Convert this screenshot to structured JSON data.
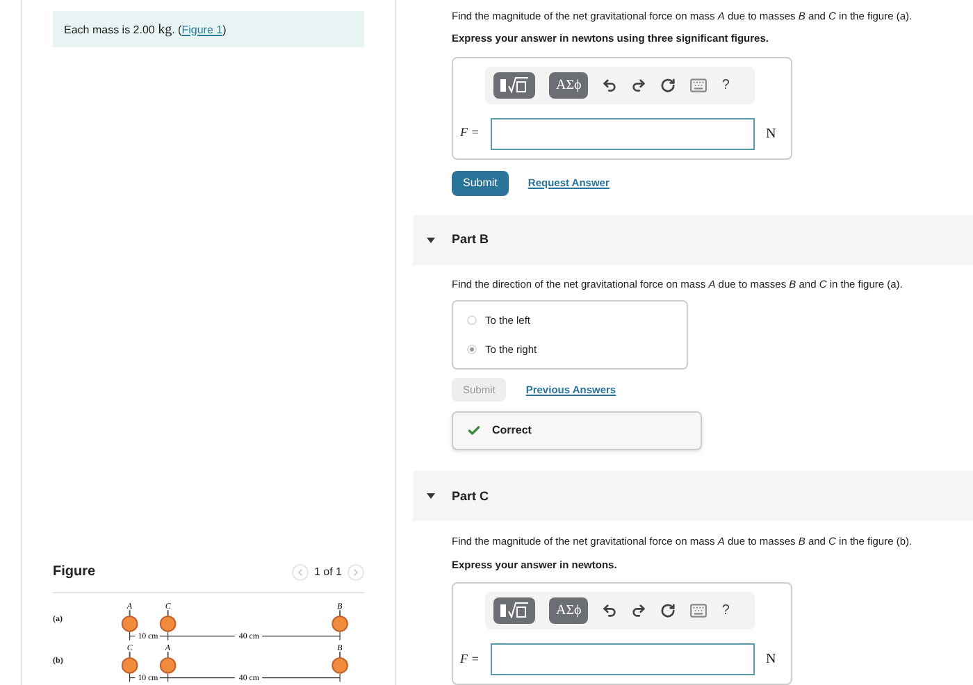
{
  "info": {
    "text": "Each mass is 2.00",
    "unit": "kg",
    "before_link": ". (",
    "link": "Figure 1",
    "after_link": ")"
  },
  "figure": {
    "title": "Figure",
    "pager": "1 of 1",
    "rows": [
      {
        "label": "(a)",
        "masses": [
          "A",
          "C",
          "B"
        ],
        "gaps": [
          "10 cm",
          "40 cm"
        ]
      },
      {
        "label": "(b)",
        "masses": [
          "C",
          "A",
          "B"
        ],
        "gaps": [
          "10 cm",
          "40 cm"
        ]
      }
    ]
  },
  "part_a": {
    "prompt": "Find the magnitude of the net gravitational force on mass *A* due to masses *B* and *C* in the figure (a).",
    "instruction": "Express your answer in newtons using three significant figures.",
    "greek": "ΑΣϕ",
    "help": "?",
    "variable": "F =",
    "unit": "N",
    "submit": "Submit",
    "link": "Request Answer"
  },
  "part_b": {
    "title": "Part B",
    "expanded": true,
    "prompt": "Find the direction of the net gravitational force on mass *A* due to masses *B* and *C* in the figure (a).",
    "options": [
      {
        "label": "To the left",
        "selected": false
      },
      {
        "label": "To the right",
        "selected": true
      }
    ],
    "submit": "Submit",
    "submit_disabled": true,
    "link": "Previous Answers",
    "feedback": "Correct"
  },
  "part_c": {
    "title": "Part C",
    "expanded": true,
    "prompt": "Find the magnitude of the net gravitational force on mass *A* due to masses *B* and *C* in the figure (b).",
    "instruction": "Express your answer in newtons.",
    "greek": "ΑΣϕ",
    "help": "?",
    "variable": "F =",
    "unit": "N"
  }
}
